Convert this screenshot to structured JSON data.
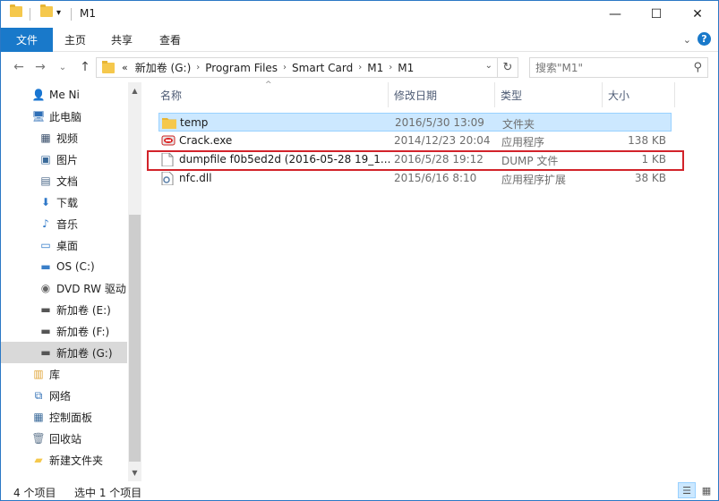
{
  "window": {
    "title": "M1"
  },
  "window_controls": {
    "minimize": "—",
    "maximize": "☐",
    "close": "✕"
  },
  "ribbon": {
    "file_tab": "文件",
    "tabs": [
      "主页",
      "共享",
      "查看"
    ],
    "expand_glyph": "⌄",
    "help_glyph": "?"
  },
  "nav": {
    "back": "←",
    "forward": "→",
    "recent": "⌄",
    "up": "↑",
    "overflow": "«",
    "breadcrumbs": [
      "新加卷 (G:)",
      "Program Files",
      "Smart Card",
      "M1",
      "M1"
    ],
    "crumb_sep": "›",
    "dropdown": "⌄",
    "refresh": "↻",
    "search_placeholder": "搜索\"M1\"",
    "search_icon": "⚲"
  },
  "sidebar": {
    "items": [
      {
        "label": "Me Ni",
        "icon": "user-icon",
        "glyph": "👤",
        "color": "#3d8b3d"
      },
      {
        "label": "此电脑",
        "icon": "computer-icon",
        "glyph": "🖥",
        "color": "#2f6fb6"
      },
      {
        "label": "视频",
        "icon": "video-icon",
        "glyph": "▦",
        "color": "#3a4f6b"
      },
      {
        "label": "图片",
        "icon": "pictures-icon",
        "glyph": "▣",
        "color": "#3a6a9a"
      },
      {
        "label": "文档",
        "icon": "documents-icon",
        "glyph": "▤",
        "color": "#4d6a8a"
      },
      {
        "label": "下载",
        "icon": "download-icon",
        "glyph": "⬇",
        "color": "#2f78c8"
      },
      {
        "label": "音乐",
        "icon": "music-icon",
        "glyph": "♪",
        "color": "#2f78c8"
      },
      {
        "label": "桌面",
        "icon": "desktop-icon",
        "glyph": "▭",
        "color": "#2f78c8"
      },
      {
        "label": "OS (C:)",
        "icon": "os-drive-icon",
        "glyph": "▬",
        "color": "#3a7fc8"
      },
      {
        "label": "DVD RW 驱动",
        "icon": "dvd-drive-icon",
        "glyph": "◉",
        "color": "#666666"
      },
      {
        "label": "新加卷 (E:)",
        "icon": "drive-icon",
        "glyph": "▬",
        "color": "#555555"
      },
      {
        "label": "新加卷 (F:)",
        "icon": "drive-icon",
        "glyph": "▬",
        "color": "#555555"
      },
      {
        "label": "新加卷 (G:)",
        "icon": "drive-icon",
        "glyph": "▬",
        "color": "#555555",
        "selected": true
      },
      {
        "label": "库",
        "icon": "library-icon",
        "glyph": "▥",
        "color": "#e0a53a"
      },
      {
        "label": "网络",
        "icon": "network-icon",
        "glyph": "⧉",
        "color": "#2f6fb6"
      },
      {
        "label": "控制面板",
        "icon": "control-panel-icon",
        "glyph": "▦",
        "color": "#3a6a9a"
      },
      {
        "label": "回收站",
        "icon": "recycle-bin-icon",
        "glyph": "🗑",
        "color": "#6a7f95"
      },
      {
        "label": "新建文件夹",
        "icon": "folder-icon",
        "glyph": "▰",
        "color": "#f5c84c"
      }
    ],
    "scroll_up": "▲",
    "scroll_down": "▼"
  },
  "list": {
    "columns": [
      "名称",
      "修改日期",
      "类型",
      "大小"
    ],
    "sort_glyph": "^",
    "rows": [
      {
        "name": "temp",
        "date": "2016/5/30 13:09",
        "type": "文件夹",
        "size": "",
        "icon": "folder-icon",
        "selected": true
      },
      {
        "name": "Crack.exe",
        "date": "2014/12/23 20:04",
        "type": "应用程序",
        "size": "138 KB",
        "icon": "exe-icon"
      },
      {
        "name": "dumpfile f0b5ed2d (2016-05-28 19_1...",
        "date": "2016/5/28 19:12",
        "type": "DUMP 文件",
        "size": "1 KB",
        "icon": "file-icon",
        "highlighted": true
      },
      {
        "name": "nfc.dll",
        "date": "2015/6/16 8:10",
        "type": "应用程序扩展",
        "size": "38 KB",
        "icon": "dll-icon"
      }
    ]
  },
  "status": {
    "count": "4 个项目",
    "selection": "选中 1 个项目",
    "details_view_glyph": "☰",
    "tiles_view_glyph": "▦"
  },
  "colors": {
    "accent": "#1979ca",
    "selection": "#cce8ff",
    "highlight_box": "#d2232a"
  }
}
